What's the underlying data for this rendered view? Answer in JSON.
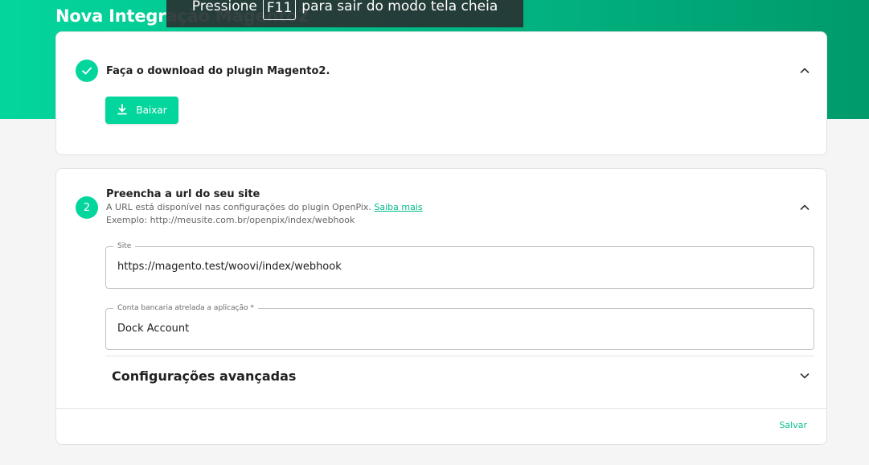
{
  "page": {
    "title": "Nova Integração Magento2"
  },
  "fullscreen_notice": {
    "prefix": "Pressione",
    "key": "F11",
    "suffix": "para sair do modo tela cheia"
  },
  "step1": {
    "title": "Faça o download do plugin Magento2.",
    "button_label": "Baixar",
    "status_icon": "check-icon"
  },
  "step2": {
    "number": "2",
    "title": "Preencha a url do seu site",
    "description": "A URL está disponível nas configurações do plugin OpenPix.",
    "learn_more": "Saiba mais",
    "example": "Exemplo: http://meusite.com.br/openpix/index/webhook",
    "site_field": {
      "label": "Site",
      "value": "https://magento.test/woovi/index/webhook"
    },
    "account_field": {
      "label": "Conta bancaria atrelada a aplicação *",
      "value": "Dock Account"
    },
    "advanced": {
      "title": "Configurações avançadas"
    },
    "save_label": "Salvar"
  },
  "colors": {
    "accent": "#03d69d",
    "accent_dark": "#009a6c"
  }
}
